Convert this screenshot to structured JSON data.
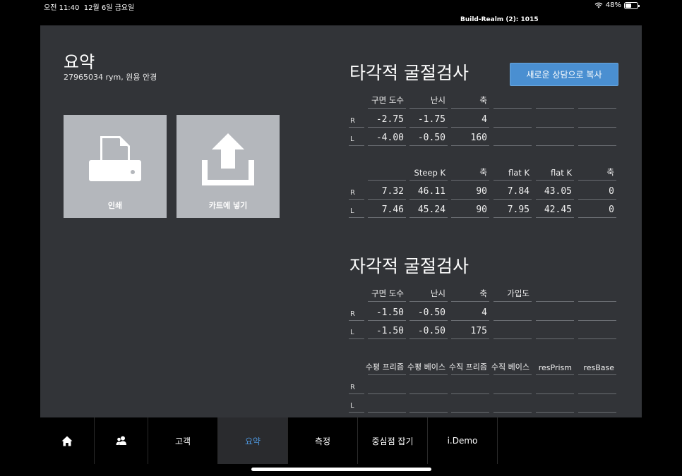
{
  "status": {
    "time": "오전 11:40",
    "date": "12월 6일 금요일",
    "battery": "48%",
    "wifi_icon": "wifi-icon"
  },
  "build_label": "Build-Realm (2): 1015",
  "summary": {
    "title": "요약",
    "subtitle": "27965034 rym, 원용 안경",
    "tiles": {
      "print": "인쇄",
      "cart": "카트에 넣기"
    }
  },
  "objective": {
    "title": "타각적 굴절검사",
    "copy_button": "새로운 상담으로 복사",
    "refraction": {
      "headers": [
        "구면 도수",
        "난시",
        "축",
        "",
        "",
        ""
      ],
      "rows": [
        {
          "side": "R",
          "values": [
            "-2.75",
            "-1.75",
            "4",
            "",
            "",
            ""
          ]
        },
        {
          "side": "L",
          "values": [
            "-4.00",
            "-0.50",
            "160",
            "",
            "",
            ""
          ]
        }
      ]
    },
    "keratometry": {
      "headers": [
        "",
        "Steep K",
        "축",
        "flat K",
        "flat K",
        "축"
      ],
      "rows": [
        {
          "side": "R",
          "values": [
            "7.32",
            "46.11",
            "90",
            "7.84",
            "43.05",
            "0"
          ]
        },
        {
          "side": "L",
          "values": [
            "7.46",
            "45.24",
            "90",
            "7.95",
            "42.45",
            "0"
          ]
        }
      ]
    }
  },
  "subjective": {
    "title": "자각적 굴절검사",
    "refraction": {
      "headers": [
        "구면 도수",
        "난시",
        "축",
        "가입도",
        "",
        ""
      ],
      "rows": [
        {
          "side": "R",
          "values": [
            "-1.50",
            "-0.50",
            "4",
            "",
            "",
            ""
          ]
        },
        {
          "side": "L",
          "values": [
            "-1.50",
            "-0.50",
            "175",
            "",
            "",
            ""
          ]
        }
      ]
    },
    "prism": {
      "headers": [
        "수평 프리즘",
        "수평 베이스",
        "수직 프리즘",
        "수직 베이스",
        "resPrism",
        "resBase"
      ],
      "rows": [
        {
          "side": "R",
          "values": [
            "",
            "",
            "",
            "",
            "",
            ""
          ]
        },
        {
          "side": "L",
          "values": [
            "",
            "",
            "",
            "",
            "",
            ""
          ]
        }
      ]
    }
  },
  "tabs": {
    "home_icon": "home-icon",
    "people_icon": "people-icon",
    "customer": "고객",
    "summary": "요약",
    "measure": "측정",
    "centering": "중심점 잡기",
    "demo": "i.Demo"
  },
  "colors": {
    "panel_bg": "#323438",
    "accent": "#4a8fd1",
    "active_tab_text": "#4d95db",
    "tile_bg": "#b4b7bc"
  }
}
